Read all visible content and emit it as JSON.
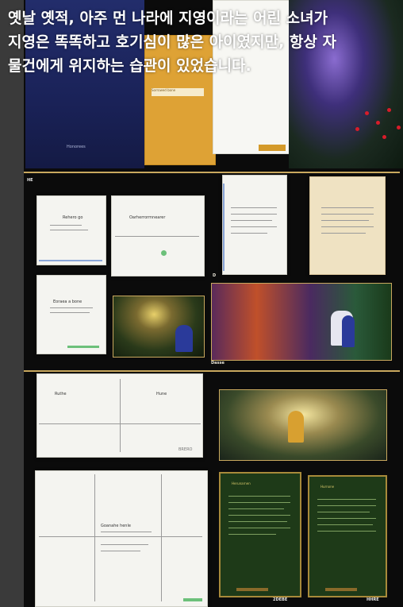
{
  "caption": {
    "line1": "옛날 옛적, 아주 먼 나라에 지영이라는 어린 소녀가",
    "line2": "지영은 똑똑하고 호기심이 많은 아이였지만, 항상 자",
    "line3": "물건에게 위지하는 습관이 있었습니다."
  },
  "board": {
    "top_navy_label": "Honorees",
    "orange_card_label": "Sorrowed bone",
    "mid_header": "HE",
    "card1_title": "Rehero go",
    "card2_title": "Oarherrormnearer",
    "card3_title": "Eoraea a bone",
    "scene1_label": "D",
    "scene2_label": "Dasse",
    "env_left": "Ruthe",
    "env_right": "Hune",
    "env_foot": "BRERO",
    "letter_title": "Goanahe henle",
    "green1_title": "Herunarnen",
    "green1_foot": "2DEBE",
    "green2_title": "Hurnone",
    "green2_foot": "HHRE"
  }
}
